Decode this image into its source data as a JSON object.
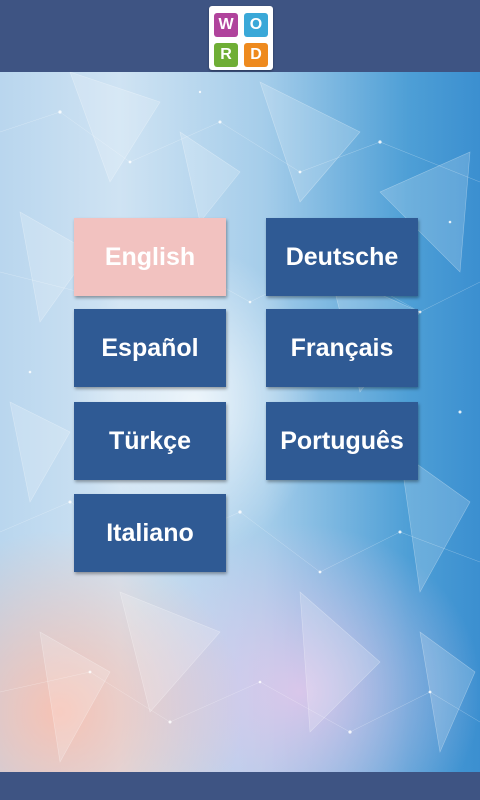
{
  "logo": {
    "letters": [
      "W",
      "O",
      "R",
      "D"
    ],
    "colors": [
      "#b0439c",
      "#3aa8d8",
      "#6fae35",
      "#ee8a1e"
    ]
  },
  "languages": [
    {
      "label": "English",
      "selected": true
    },
    {
      "label": "Deutsche",
      "selected": false
    },
    {
      "label": "Español",
      "selected": false
    },
    {
      "label": "Français",
      "selected": false
    },
    {
      "label": "Türkçe",
      "selected": false
    },
    {
      "label": "Português",
      "selected": false
    },
    {
      "label": "Italiano",
      "selected": false
    }
  ],
  "colors": {
    "header_bar": "#3e5483",
    "button": "#2f5a94",
    "button_selected": "#f2c2c0",
    "button_text": "#ffffff"
  }
}
